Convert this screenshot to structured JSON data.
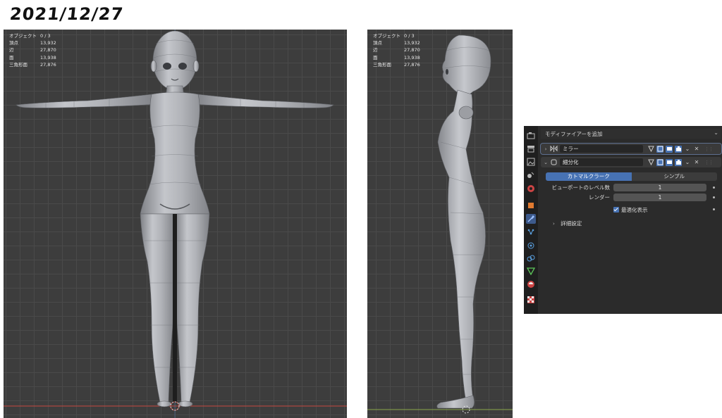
{
  "title": "2021/12/27",
  "stats": [
    {
      "label": "オブジェクト",
      "value": "0 / 3"
    },
    {
      "label": "頂点",
      "value": "13,932"
    },
    {
      "label": "辺",
      "value": "27,870"
    },
    {
      "label": "面",
      "value": "13,938"
    },
    {
      "label": "三角形面",
      "value": "27,876"
    }
  ],
  "colors": {
    "viewport_bg": "#3d3d3d",
    "grid": "#4a4a4a",
    "x_axis": "#c8473f",
    "y_axis": "#8aa84a",
    "accent": "#4772b3",
    "panel_bg": "#2b2b2b"
  },
  "properties": {
    "add_modifier": "モディファイアーを追加",
    "modifiers": [
      {
        "name": "ミラー",
        "expanded": false,
        "icon": "mirror-icon"
      },
      {
        "name": "細分化",
        "expanded": true,
        "icon": "subdivision-icon"
      }
    ],
    "subdiv": {
      "mode_options": [
        "カトマルクラーク",
        "シンプル"
      ],
      "mode_selected": "カトマルクラーク",
      "viewport_label": "ビューポートのレベル数",
      "viewport_value": "1",
      "render_label": "レンダー",
      "render_value": "1",
      "optimal_label": "最適化表示",
      "optimal_checked": true,
      "advanced_label": "詳細設定"
    },
    "tab_icons": [
      "tool-icon",
      "render-icon",
      "output-icon",
      "view-layer-icon",
      "scene-icon",
      "world-icon",
      "object-icon",
      "modifier-icon",
      "particles-icon",
      "physics-icon",
      "constraints-icon",
      "data-icon",
      "material-icon",
      "texture-icon"
    ],
    "active_tab": "modifier-icon"
  }
}
